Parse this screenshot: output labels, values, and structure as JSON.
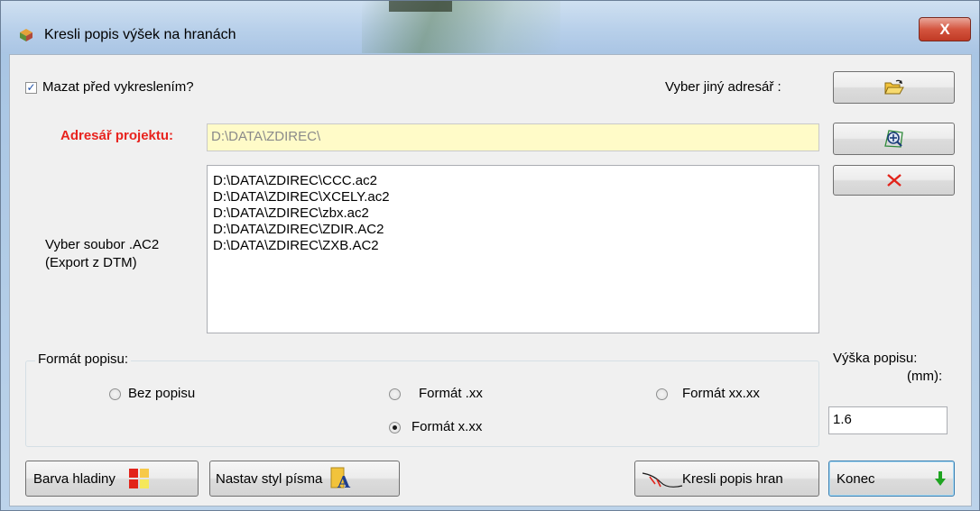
{
  "window": {
    "title": "Kresli popis výšek na hranách",
    "close_label": "X"
  },
  "options": {
    "delete_before_draw_label": "Mazat před vykreslením?",
    "delete_before_draw_checked": true,
    "choose_dir_label": "Vyber jiný adresář :"
  },
  "project": {
    "label": "Adresář projektu:",
    "path": "D:\\DATA\\ZDIREC\\"
  },
  "file_select": {
    "label_line1": "Vyber soubor .AC2",
    "label_line2": "(Export z DTM)",
    "files": [
      "D:\\DATA\\ZDIREC\\CCC.ac2",
      "D:\\DATA\\ZDIREC\\XCELY.ac2",
      "D:\\DATA\\ZDIREC\\zbx.ac2",
      "D:\\DATA\\ZDIREC\\ZDIR.AC2",
      "D:\\DATA\\ZDIREC\\ZXB.AC2"
    ]
  },
  "format": {
    "group_label": "Formát popisu:",
    "options": {
      "none": "Bez popisu",
      "dot_xx": "Formát .xx",
      "xx_xx": "Formát xx.xx",
      "x_xx": "Formát x.xx"
    },
    "selected": "x_xx"
  },
  "height": {
    "label_line1": "Výška popisu:",
    "label_line2": "(mm):",
    "value": "1.6"
  },
  "buttons": {
    "layer_color": "Barva hladiny",
    "font_style": "Nastav styl písma",
    "draw_edges": "Kresli popis hran",
    "end": "Konec"
  },
  "icons": {
    "folder_open": "folder-open-icon",
    "zoom_project": "zoom-magnifier-icon",
    "delete": "red-x-icon",
    "layer_color": "color-grid-icon",
    "font_style": "font-a-icon",
    "draw_edges": "edge-line-icon",
    "end": "green-down-arrow-icon"
  },
  "colors": {
    "project_label": "#e8231e",
    "project_field_bg": "#fffbc8",
    "delete_icon": "#e2231a",
    "end_arrow": "#1fa421"
  }
}
